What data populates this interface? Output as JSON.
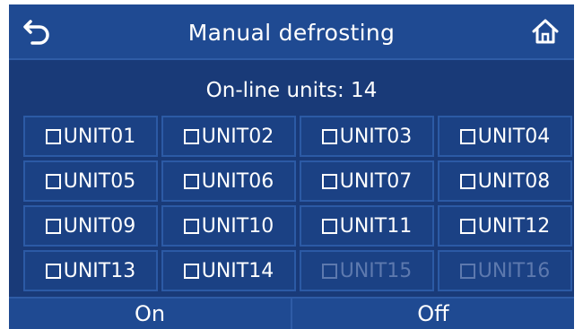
{
  "header": {
    "title": "Manual defrosting",
    "back_icon": "back-arrow-icon",
    "home_icon": "home-icon"
  },
  "status": {
    "online_units_text": "On-line units: 14"
  },
  "units": [
    {
      "label": "UNIT01",
      "checked": false,
      "enabled": true
    },
    {
      "label": "UNIT02",
      "checked": false,
      "enabled": true
    },
    {
      "label": "UNIT03",
      "checked": false,
      "enabled": true
    },
    {
      "label": "UNIT04",
      "checked": false,
      "enabled": true
    },
    {
      "label": "UNIT05",
      "checked": false,
      "enabled": true
    },
    {
      "label": "UNIT06",
      "checked": false,
      "enabled": true
    },
    {
      "label": "UNIT07",
      "checked": false,
      "enabled": true
    },
    {
      "label": "UNIT08",
      "checked": false,
      "enabled": true
    },
    {
      "label": "UNIT09",
      "checked": false,
      "enabled": true
    },
    {
      "label": "UNIT10",
      "checked": false,
      "enabled": true
    },
    {
      "label": "UNIT11",
      "checked": false,
      "enabled": true
    },
    {
      "label": "UNIT12",
      "checked": false,
      "enabled": true
    },
    {
      "label": "UNIT13",
      "checked": false,
      "enabled": true
    },
    {
      "label": "UNIT14",
      "checked": false,
      "enabled": true
    },
    {
      "label": "UNIT15",
      "checked": false,
      "enabled": false
    },
    {
      "label": "UNIT16",
      "checked": false,
      "enabled": false
    }
  ],
  "actions": {
    "on_label": "On",
    "off_label": "Off"
  },
  "colors": {
    "background": "#193a78",
    "header": "#1f4a92",
    "cell": "#1b4184",
    "cell_border": "#2c5aa5",
    "text": "#ffffff",
    "disabled_text": "#5d79ae"
  }
}
